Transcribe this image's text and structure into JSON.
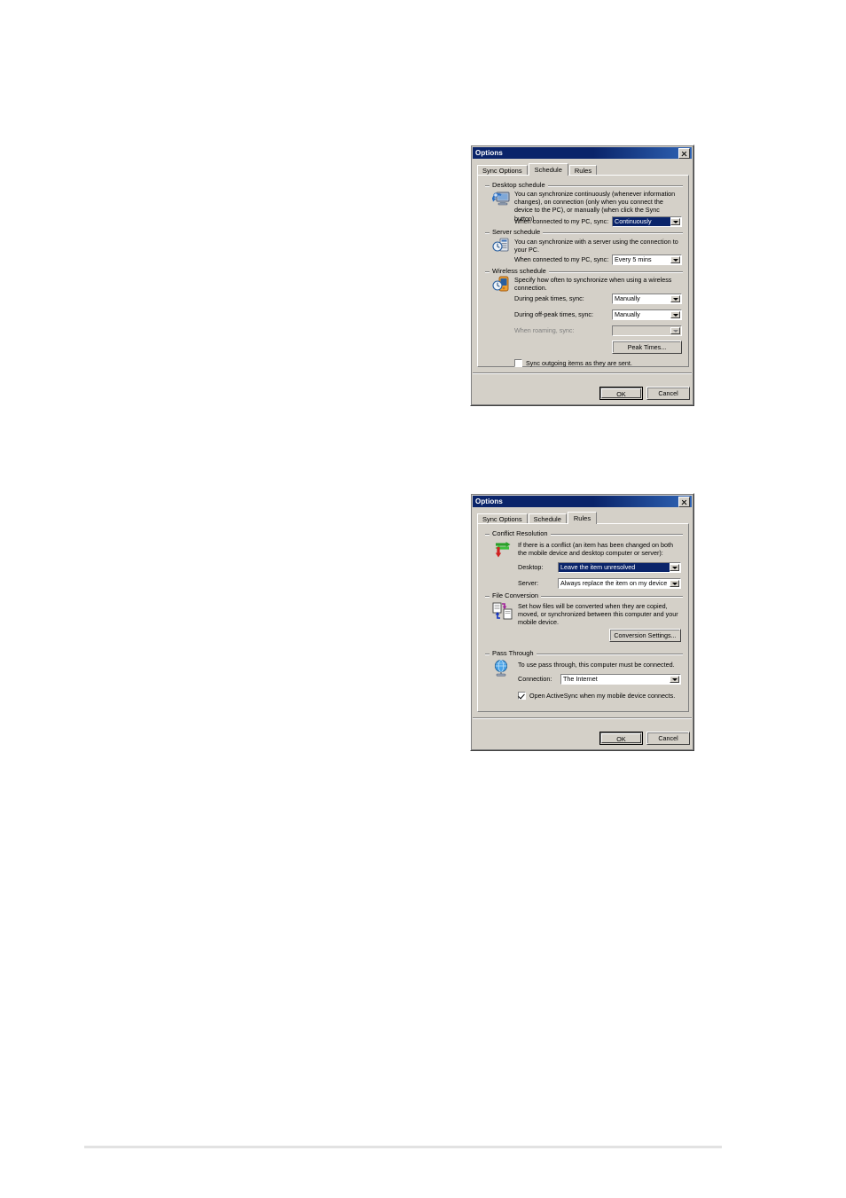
{
  "page": {
    "background": "#ffffff",
    "footer_rule_color": "#e2e2e2"
  },
  "colors": {
    "dialog_face": "#d4d0c8",
    "titlebar_start": "#0a246a",
    "titlebar_end": "#2f64b5",
    "titlebar_text": "#ffffff",
    "selection_bg": "#0a246a",
    "disabled_text": "#808080"
  },
  "dialogs": [
    {
      "id": "options-schedule",
      "title": "Options",
      "close_icon": "close-icon",
      "tabs": [
        {
          "label": "Sync Options",
          "active": false
        },
        {
          "label": "Schedule",
          "active": true
        },
        {
          "label": "Rules",
          "active": false
        }
      ],
      "groups": [
        {
          "id": "desktop-schedule",
          "title": "Desktop schedule",
          "icon": "desktop-sync-icon",
          "description": "You can synchronize continuously (whenever information changes), on connection (only when you connect the device to the PC), or manually (when click the Sync button).",
          "fields": [
            {
              "label": "When connected to my PC, sync:",
              "value": "Continuously",
              "selected": true,
              "disabled": false
            }
          ]
        },
        {
          "id": "server-schedule",
          "title": "Server schedule",
          "icon": "server-clock-icon",
          "description": "You can synchronize with a server using the connection to your PC.",
          "fields": [
            {
              "label": "When connected to my PC, sync:",
              "value": "Every 5 mins",
              "selected": false,
              "disabled": false
            }
          ]
        },
        {
          "id": "wireless-schedule",
          "title": "Wireless schedule",
          "icon": "mobile-clock-icon",
          "description": "Specify how often to synchronize when using a wireless connection.",
          "fields": [
            {
              "label": "During peak times, sync:",
              "value": "Manually",
              "selected": false,
              "disabled": false
            },
            {
              "label": "During off-peak times, sync:",
              "value": "Manually",
              "selected": false,
              "disabled": false
            },
            {
              "label": "When roaming, sync:",
              "value": "",
              "selected": false,
              "disabled": true
            }
          ],
          "button": "Peak Times..."
        }
      ],
      "checkbox": {
        "label": "Sync outgoing items as they are sent.",
        "checked": false
      },
      "footer_buttons": {
        "ok": "OK",
        "cancel": "Cancel"
      }
    },
    {
      "id": "options-rules",
      "title": "Options",
      "close_icon": "close-icon",
      "tabs": [
        {
          "label": "Sync Options",
          "active": false
        },
        {
          "label": "Schedule",
          "active": false
        },
        {
          "label": "Rules",
          "active": true
        }
      ],
      "groups": [
        {
          "id": "conflict-resolution",
          "title": "Conflict Resolution",
          "icon": "conflict-arrows-icon",
          "description": "If there is a conflict (an item has been changed on both the mobile device and desktop computer or server):",
          "fields": [
            {
              "label": "Desktop:",
              "value": "Leave the item unresolved",
              "selected": true,
              "disabled": false
            },
            {
              "label": "Server:",
              "value": "Always replace the item on my device",
              "selected": false,
              "disabled": false
            }
          ]
        },
        {
          "id": "file-conversion",
          "title": "File Conversion",
          "icon": "file-convert-icon",
          "description": "Set how files will be converted when they are copied, moved, or synchronized between this computer and your mobile device.",
          "fields": [],
          "button": "Conversion Settings..."
        },
        {
          "id": "pass-through",
          "title": "Pass Through",
          "icon": "globe-icon",
          "description": "To use pass through, this computer must be connected.",
          "fields": [
            {
              "label": "Connection:",
              "value": "The Internet",
              "selected": false,
              "disabled": false
            }
          ]
        }
      ],
      "checkbox": {
        "label": "Open ActiveSync when my mobile device connects.",
        "checked": true
      },
      "footer_buttons": {
        "ok": "OK",
        "cancel": "Cancel"
      }
    }
  ]
}
